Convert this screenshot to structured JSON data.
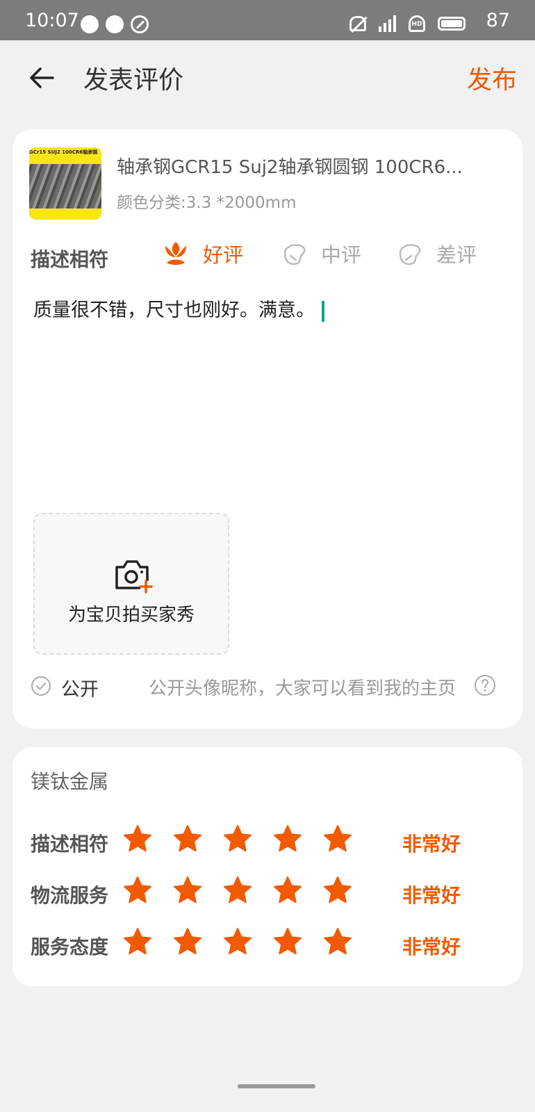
{
  "status_bar": {
    "time": "10:07",
    "network": "4G",
    "hd": "HD",
    "battery": "87"
  },
  "header": {
    "title": "发表评价",
    "publish_label": "发布"
  },
  "product": {
    "title": "轴承钢GCR15 Suj2轴承钢圆钢 100CR6...",
    "spec": "颜色分类:3.3 *2000mm",
    "thumb_caption": "GCr15 SUJ2 100CR6轴承钢"
  },
  "rating": {
    "label": "描述相符",
    "options": [
      {
        "label": "好评",
        "selected": true
      },
      {
        "label": "中评",
        "selected": false
      },
      {
        "label": "差评",
        "selected": false
      }
    ]
  },
  "review": {
    "text": "质量很不错，尺寸也刚好。满意。"
  },
  "photo": {
    "label": "为宝贝拍买家秀"
  },
  "public": {
    "label": "公开",
    "description": "公开头像昵称，大家可以看到我的主页"
  },
  "shop_scores": {
    "shop_name": "镁钛金属",
    "rows": [
      {
        "label": "描述相符",
        "stars": 5,
        "text": "非常好"
      },
      {
        "label": "物流服务",
        "stars": 5,
        "text": "非常好"
      },
      {
        "label": "服务态度",
        "stars": 5,
        "text": "非常好"
      }
    ]
  },
  "colors": {
    "accent": "#f25a00",
    "cursor": "#0fa38d",
    "status_bar": "#7c7c7c",
    "background": "#f1f1f1"
  }
}
